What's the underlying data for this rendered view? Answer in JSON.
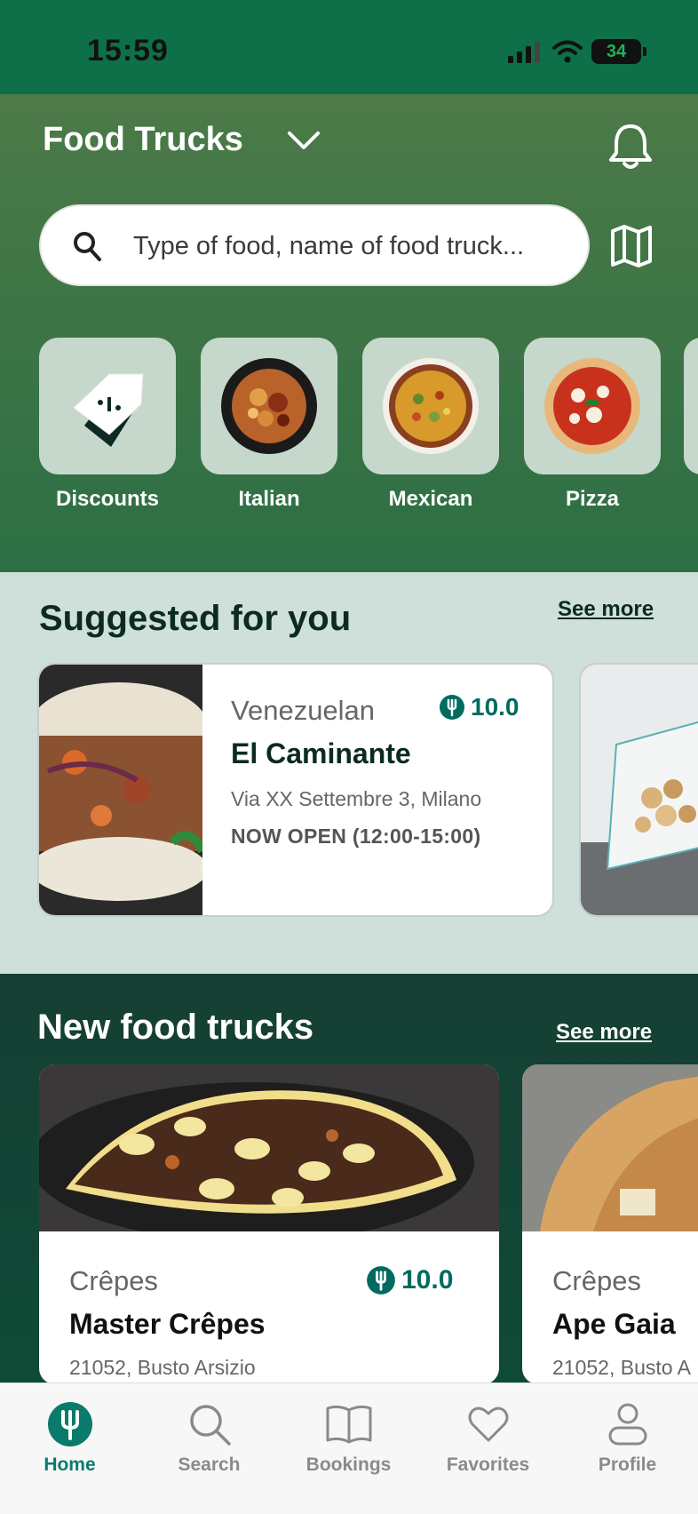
{
  "status_bar": {
    "time": "15:59",
    "battery": "34"
  },
  "header": {
    "title": "Food Trucks"
  },
  "search": {
    "placeholder": "Type of food, name of food truck..."
  },
  "categories": [
    {
      "label": "Discounts"
    },
    {
      "label": "Italian"
    },
    {
      "label": "Mexican"
    },
    {
      "label": "Pizza"
    }
  ],
  "suggested": {
    "title": "Suggested for you",
    "see_more": "See more",
    "cards": [
      {
        "cuisine": "Venezuelan",
        "rating": "10.0",
        "name": "El Caminante",
        "address": "Via XX Settembre 3, Milano",
        "hours": "NOW OPEN (12:00-15:00)"
      }
    ]
  },
  "new_trucks": {
    "title": "New food trucks",
    "see_more": "See more",
    "cards": [
      {
        "cuisine": "Crêpes",
        "rating": "10.0",
        "name": "Master Crêpes",
        "address": "21052, Busto Arsizio"
      },
      {
        "cuisine": "Crêpes",
        "name": "Ape Gaia",
        "address": "21052, Busto A"
      }
    ]
  },
  "tabbar": {
    "tabs": [
      {
        "label": "Home"
      },
      {
        "label": "Search"
      },
      {
        "label": "Bookings"
      },
      {
        "label": "Favorites"
      },
      {
        "label": "Profile"
      }
    ]
  },
  "colors": {
    "brand": "#0e7048",
    "accent": "#0a7a6a",
    "rating": "#006b5e"
  }
}
